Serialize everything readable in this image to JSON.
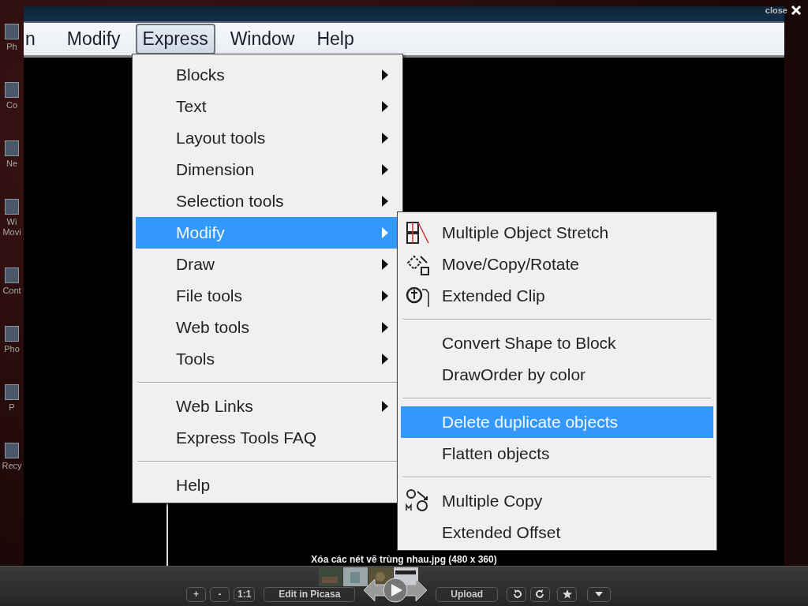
{
  "desktop": {
    "icons": [
      {
        "label": "Ph"
      },
      {
        "label": "Co"
      },
      {
        "label": "Ne"
      },
      {
        "label": "Wi\nMovi"
      },
      {
        "label": "Cont"
      },
      {
        "label": "Pho"
      },
      {
        "label": "P"
      },
      {
        "label": "Recy"
      }
    ]
  },
  "viewer": {
    "close_label": "close",
    "caption": "Xóa các nét vẽ trùng nhau.jpg (480 x 360)"
  },
  "image": {
    "menubar": [
      {
        "label": "n",
        "selected": false
      },
      {
        "label": "Modify",
        "selected": false
      },
      {
        "label": "Express",
        "selected": true
      },
      {
        "label": "Window",
        "selected": false
      },
      {
        "label": "Help",
        "selected": false
      }
    ],
    "express_menu": [
      {
        "kind": "item",
        "label": "Blocks",
        "submenu": true,
        "selected": false
      },
      {
        "kind": "item",
        "label": "Text",
        "submenu": true,
        "selected": false
      },
      {
        "kind": "item",
        "label": "Layout tools",
        "submenu": true,
        "selected": false
      },
      {
        "kind": "item",
        "label": "Dimension",
        "submenu": true,
        "selected": false
      },
      {
        "kind": "item",
        "label": "Selection tools",
        "submenu": true,
        "selected": false
      },
      {
        "kind": "item",
        "label": "Modify",
        "submenu": true,
        "selected": true
      },
      {
        "kind": "item",
        "label": "Draw",
        "submenu": true,
        "selected": false
      },
      {
        "kind": "item",
        "label": "File tools",
        "submenu": true,
        "selected": false
      },
      {
        "kind": "item",
        "label": "Web tools",
        "submenu": true,
        "selected": false
      },
      {
        "kind": "item",
        "label": "Tools",
        "submenu": true,
        "selected": false
      },
      {
        "kind": "separator"
      },
      {
        "kind": "item",
        "label": "Web Links",
        "submenu": true,
        "selected": false
      },
      {
        "kind": "item",
        "label": "Express Tools FAQ",
        "submenu": false,
        "selected": false
      },
      {
        "kind": "separator"
      },
      {
        "kind": "item",
        "label": "Help",
        "submenu": false,
        "selected": false
      }
    ],
    "modify_submenu": [
      {
        "kind": "icon_item",
        "label": "Multiple Object Stretch",
        "selected": false
      },
      {
        "kind": "icon_item",
        "label": "Move/Copy/Rotate",
        "selected": false
      },
      {
        "kind": "icon_item",
        "label": "Extended Clip",
        "selected": false
      },
      {
        "kind": "separator"
      },
      {
        "kind": "item",
        "label": "Convert Shape to Block",
        "selected": false
      },
      {
        "kind": "item",
        "label": "DrawOrder by color",
        "selected": false
      },
      {
        "kind": "separator"
      },
      {
        "kind": "item",
        "label": "Delete duplicate objects",
        "selected": true
      },
      {
        "kind": "item",
        "label": "Flatten objects",
        "selected": false
      },
      {
        "kind": "separator"
      },
      {
        "kind": "icon_item",
        "label": "Multiple Copy",
        "selected": false
      },
      {
        "kind": "item",
        "label": "Extended Offset",
        "selected": false
      }
    ]
  },
  "toolbar": [
    {
      "kind": "text",
      "label": "+"
    },
    {
      "kind": "text",
      "label": "-"
    },
    {
      "kind": "text",
      "label": "1:1"
    },
    {
      "kind": "wide",
      "label": "Edit in Picasa"
    },
    {
      "kind": "play"
    },
    {
      "kind": "wide",
      "label": "Upload"
    },
    {
      "kind": "rotate_left"
    },
    {
      "kind": "rotate_right"
    },
    {
      "kind": "star"
    },
    {
      "kind": "menu"
    }
  ]
}
